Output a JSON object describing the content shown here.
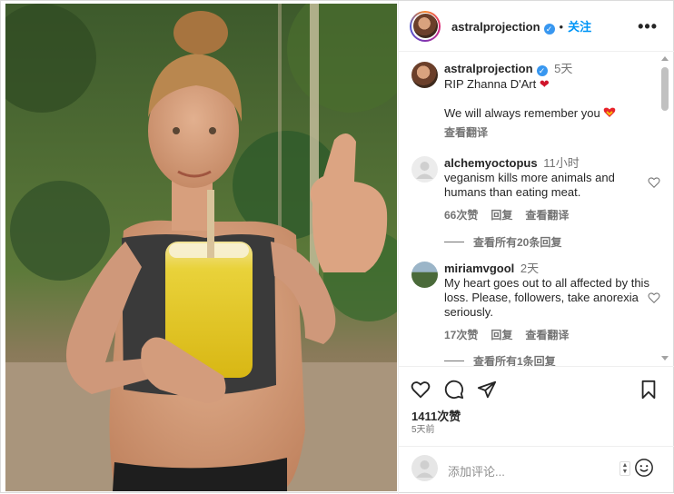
{
  "post": {
    "author": "astralprojection",
    "follow_label": "关注",
    "more_icon": "ellipsis-icon",
    "dot": "•"
  },
  "caption": {
    "author": "astralprojection",
    "time": "5天",
    "line1": "RIP Zhanna D'Art",
    "line2": "We will always remember you",
    "translate": "查看翻译",
    "emoji1": "red-heart-icon",
    "emoji2": "heart-emoji-icon"
  },
  "comments": [
    {
      "author": "alchemyoctopus",
      "time": "11小时",
      "text": "veganism kills more animals and humans than eating meat.",
      "likes": "66次赞",
      "reply": "回复",
      "translate": "查看翻译",
      "view_replies": "查看所有20条回复"
    },
    {
      "author": "miriamvgool",
      "time": "2天",
      "text": "My heart goes out to all affected by this loss. Please, followers, take anorexia seriously.",
      "likes": "17次赞",
      "reply": "回复",
      "translate": "查看翻译",
      "view_replies": "查看所有1条回复"
    }
  ],
  "actions": {
    "like_icon": "heart-icon",
    "comment_icon": "comment-icon",
    "share_icon": "paper-plane-icon",
    "save_icon": "bookmark-icon",
    "likes": "1411次赞",
    "posted": "5天前"
  },
  "composer": {
    "placeholder": "添加评论...",
    "emoji_icon": "smiley-icon"
  },
  "colors": {
    "accent": "#0095f6",
    "verified": "#3897f0",
    "muted": "#737373"
  }
}
